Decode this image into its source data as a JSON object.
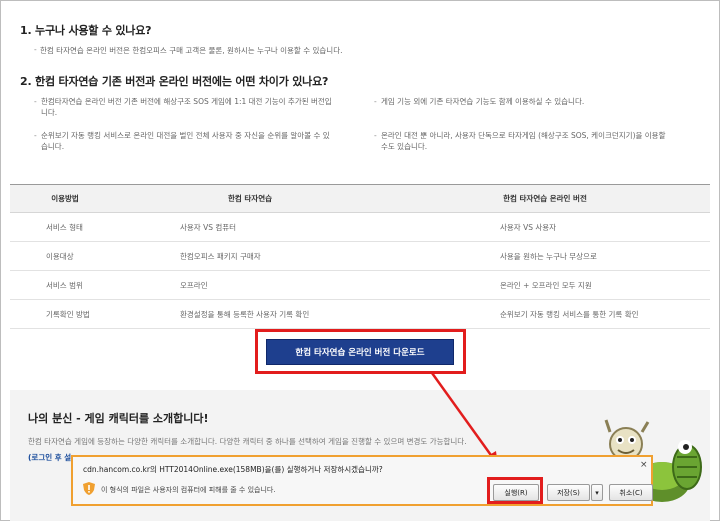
{
  "faq": {
    "q1": {
      "title": "1. 누구나 사용할 수 있나요?",
      "desc": "한컴 타자연습 온라인 버전은 한컴오피스 구매 고객은 물론, 원하시는 누구나 이용할 수 있습니다."
    },
    "q2": {
      "title": "2. 한컴 타자연습 기존 버전과 온라인 버전에는 어떤 차이가 있나요?",
      "bullets": [
        "한컴타자연습 온라인 버전 기존 버전에 해상구조 SOS 게임에 1:1 대전 기능이 추가된 버전입니다.",
        "게임 기능 외에 기존 타자연습 기능도 함께 이용하실 수 있습니다.",
        "순위보기 자동 랭킹 서비스로 온라인 대전을 벌인 전체 사용자 중 자신을 순위를 알아볼 수 있습니다.",
        "온라인 대전 뿐 아니라, 사용자 단독으로 타자게임 (해상구조 SOS, 케이크던지기)을 이용할 수도 있습니다."
      ]
    }
  },
  "table": {
    "headers": [
      "이용방법",
      "한컴 타자연습",
      "한컴 타자연습 온라인 버전"
    ],
    "rows": [
      [
        "서비스 형태",
        "사용자 VS 컴퓨터",
        "사용자 VS 사용자"
      ],
      [
        "이용대상",
        "한컴오피스 패키지 구매자",
        "사용을 원하는 누구나 무상으로"
      ],
      [
        "서비스 범위",
        "오프라인",
        "온라인 + 오프라인 모두 지원"
      ],
      [
        "기록확인 방법",
        "환경설정을 통해 등록한 사용자 기록 확인",
        "순위보기 자동 랭킹 서비스를 통한 기록 확인"
      ]
    ]
  },
  "download_button": "한컴 타자연습 온라인 버전 다운로드",
  "characters": {
    "title": "나의 분신 - 게임 캐릭터를 소개합니다!",
    "desc": "한컴 타자연습 게임에 등장하는 다양한 캐릭터를 소개합니다. 다양한 캐릭터 중 하나를 선택하여 게임을 진행할 수 있으며 변경도 가능합니다.",
    "login_prefix": "(로그인 후 설"
  },
  "dialog": {
    "message": "cdn.hancom.co.kr의 HTT2014Online.exe(158MB)을(를) 실행하거나 저장하시겠습니까?",
    "warning": "이 형식의 파일은 사용자의 컴퓨터에 피해를 줄 수 있습니다.",
    "run": "실행(R)",
    "save": "저장(S)",
    "save_dropdown": "▾",
    "cancel": "취소(C)",
    "close": "×"
  },
  "colors": {
    "highlight": "#e21d1d",
    "button_bg": "#1e3f8e",
    "dialog_border": "#f0a030"
  }
}
